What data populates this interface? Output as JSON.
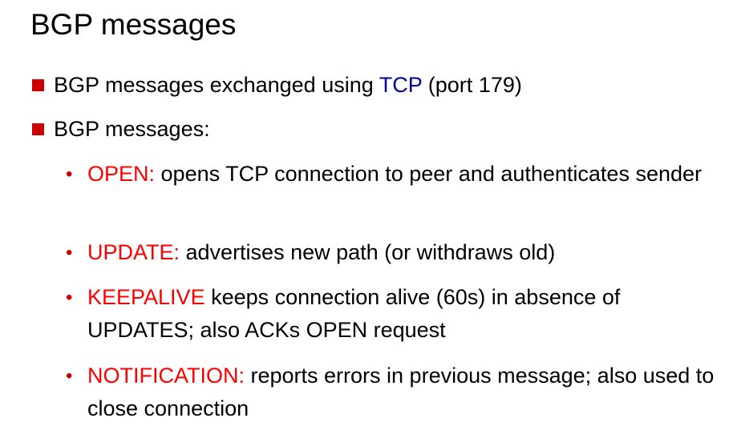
{
  "slide": {
    "title": "BGP messages",
    "bullets": [
      {
        "pre": "BGP messages exchanged using ",
        "highlight": "TCP",
        "post": " (port 179)"
      },
      {
        "text": "BGP messages:"
      }
    ],
    "bullet_glyph": "•",
    "messages": [
      {
        "keyword": "OPEN:",
        "text": " opens TCP connection to peer and authenticates sender"
      },
      {
        "keyword": "UPDATE:",
        "text": " advertises new path (or withdraws old)"
      },
      {
        "keyword": "KEEPALIVE",
        "text": " keeps connection alive (60s) in absence of UPDATES; also ACKs OPEN request"
      },
      {
        "keyword": "NOTIFICATION:",
        "text": " reports errors in previous message; also used to close connection"
      }
    ]
  },
  "colors": {
    "bullet_square": "#cc0000",
    "keyword": "#ff0000",
    "tcp_highlight": "#000099"
  }
}
